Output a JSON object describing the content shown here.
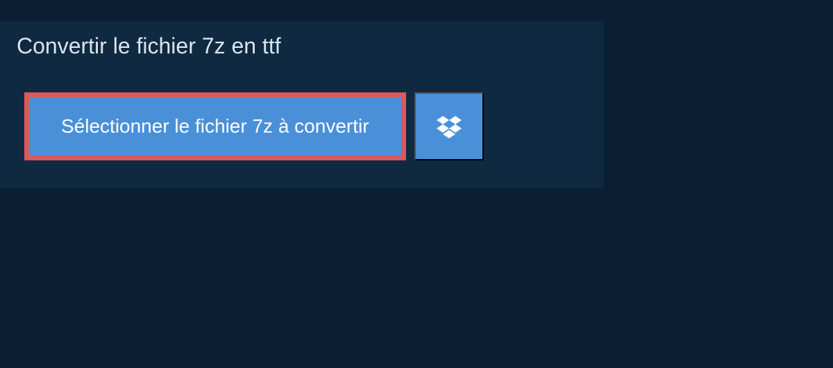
{
  "header": {
    "title": "Convertir le fichier 7z en ttf"
  },
  "actions": {
    "select_file_label": "Sélectionner le fichier 7z à convertir"
  },
  "colors": {
    "page_bg": "#0a1f33",
    "panel_bg": "#0f2940",
    "button_bg": "#4a90d9",
    "highlight_border": "#d85a5a",
    "text_light": "#d8e4ee"
  }
}
